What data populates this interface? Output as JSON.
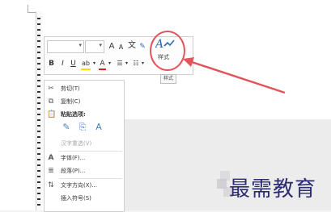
{
  "toolbar": {
    "font_name": "",
    "font_size": "",
    "grow_font": "A",
    "shrink_font": "A",
    "wen_label": "文",
    "bold": "B",
    "italic": "I",
    "underline": "U",
    "highlight": "ab",
    "font_color": "A",
    "styles_label": "样式",
    "styles_tooltip": "样式"
  },
  "context_menu": {
    "items": [
      {
        "label": "剪切(T)",
        "icon": "scissors-icon"
      },
      {
        "label": "复制(C)",
        "icon": "copy-icon"
      },
      {
        "label": "粘贴选项:",
        "icon": "paste-icon"
      },
      {
        "label": "汉字重选(V)",
        "icon": "",
        "disabled": true
      },
      {
        "label": "字体(F)...",
        "icon": "font-icon"
      },
      {
        "label": "段落(P)...",
        "icon": "paragraph-icon"
      },
      {
        "label": "文字方向(X)...",
        "icon": "text-direction-icon"
      },
      {
        "label": "插入符号(S)",
        "icon": ""
      }
    ]
  },
  "watermark": {
    "text": "最需教育"
  },
  "colors": {
    "annotation": "#e1555a",
    "watermark": "#2c2c6e"
  }
}
